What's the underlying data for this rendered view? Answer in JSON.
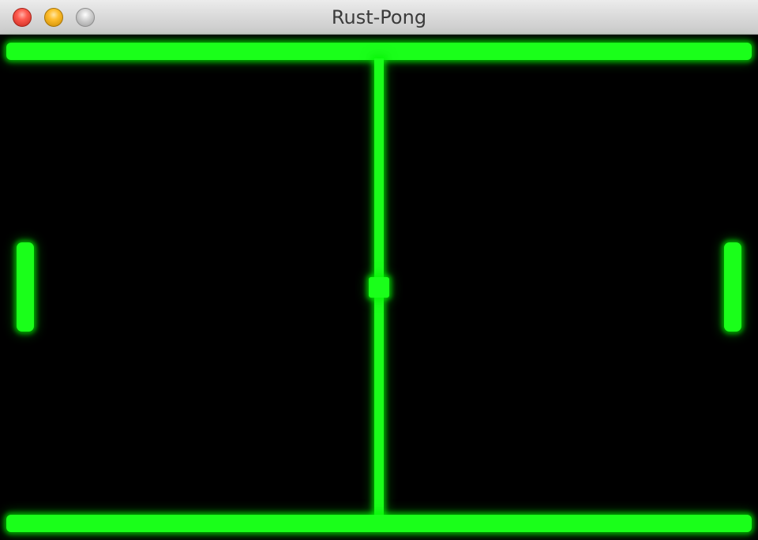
{
  "window": {
    "title": "Rust-Pong",
    "controls": {
      "close_icon": "close-icon",
      "minimize_icon": "minimize-icon",
      "zoom_icon": "zoom-icon"
    }
  },
  "game": {
    "color": "#00ff00",
    "background": "#000000",
    "elements": [
      "top-wall",
      "bottom-wall",
      "center-net",
      "left-paddle",
      "right-paddle",
      "ball"
    ]
  }
}
